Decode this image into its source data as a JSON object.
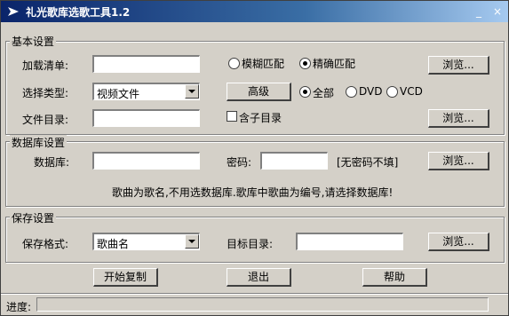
{
  "window": {
    "title": "礼光歌库选歌工具1.2",
    "minimize": "_",
    "close": "×"
  },
  "basic": {
    "legend": "基本设置",
    "load_list_label": "加载清单:",
    "match_fuzzy": "模糊匹配",
    "match_exact": "精确匹配",
    "browse1": "浏览...",
    "type_label": "选择类型:",
    "type_value": "视频文件",
    "advanced": "高级",
    "radio_all": "全部",
    "radio_dvd": "DVD",
    "radio_vcd": "VCD",
    "dir_label": "文件目录:",
    "include_sub": "含子目录",
    "browse2": "浏览..."
  },
  "db": {
    "legend": "数据库设置",
    "db_label": "数据库:",
    "pwd_label": "密码:",
    "no_pwd": "[无密码不填]",
    "browse": "浏览...",
    "hint": "歌曲为歌名,不用选数据库.歌库中歌曲为编号,请选择数据库!"
  },
  "save": {
    "legend": "保存设置",
    "format_label": "保存格式:",
    "format_value": "歌曲名",
    "target_label": "目标目录:",
    "browse": "浏览..."
  },
  "actions": {
    "start": "开始复制",
    "exit": "退出",
    "help": "帮助"
  },
  "status": {
    "progress_label": "进度:"
  }
}
